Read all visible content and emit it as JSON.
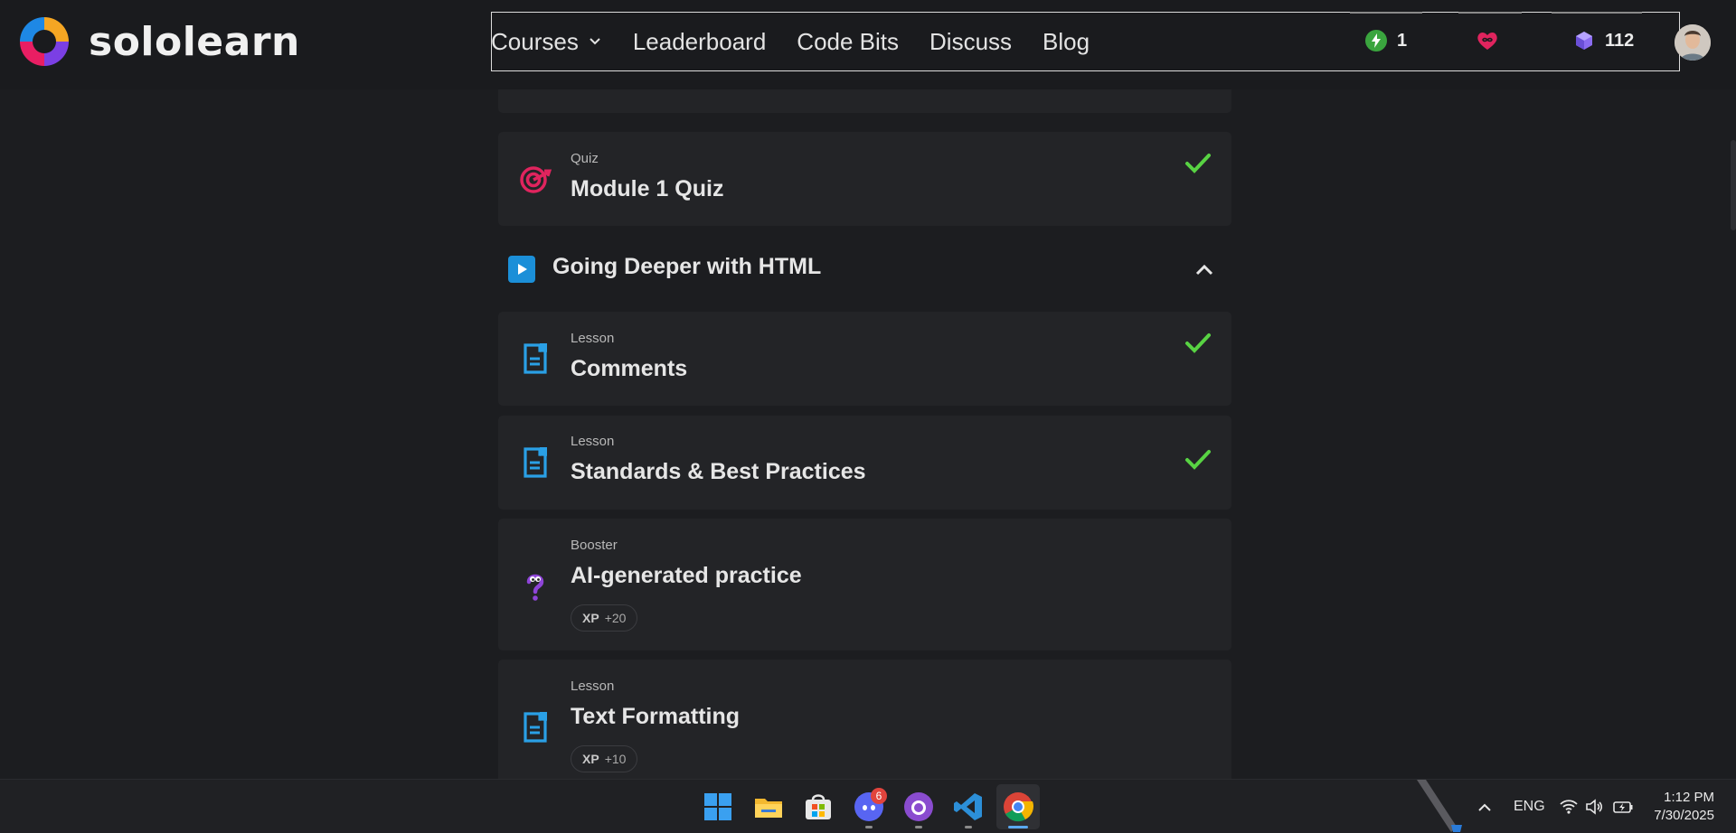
{
  "brand": {
    "name": "sololearn"
  },
  "nav": {
    "items": [
      {
        "label": "Courses"
      },
      {
        "label": "Leaderboard"
      },
      {
        "label": "Code Bits"
      },
      {
        "label": "Discuss"
      },
      {
        "label": "Blog"
      }
    ]
  },
  "stats": {
    "streak": "1",
    "hearts": "",
    "gems": "112"
  },
  "cards": [
    {
      "kind": "Quiz",
      "title": "Module 1 Quiz",
      "completed": true,
      "icon": "target-icon",
      "accent": "#e0245e"
    },
    {
      "kind": "Lesson",
      "title": "Comments",
      "completed": true,
      "icon": "lesson-document-icon",
      "accent": "#2aa0e6"
    },
    {
      "kind": "Lesson",
      "title": "Standards & Best Practices",
      "completed": true,
      "icon": "lesson-document-icon",
      "accent": "#2aa0e6"
    },
    {
      "kind": "Booster",
      "title": "AI-generated practice",
      "completed": false,
      "icon": "question-booster-icon",
      "accent": "#8e44d8",
      "xp_label": "XP",
      "xp_value": "+20"
    },
    {
      "kind": "Lesson",
      "title": "Text Formatting",
      "completed": false,
      "icon": "lesson-document-icon",
      "accent": "#2aa0e6",
      "xp_label": "XP",
      "xp_value": "+10"
    }
  ],
  "section": {
    "title": "Going Deeper with HTML",
    "expanded": true
  },
  "colors": {
    "check": "#58d343",
    "accent_blue": "#1b8fd8",
    "quiz_red": "#e0245e"
  },
  "taskbar": {
    "discord_badge": "6",
    "language": "ENG",
    "time": "1:12 PM",
    "date": "7/30/2025"
  }
}
